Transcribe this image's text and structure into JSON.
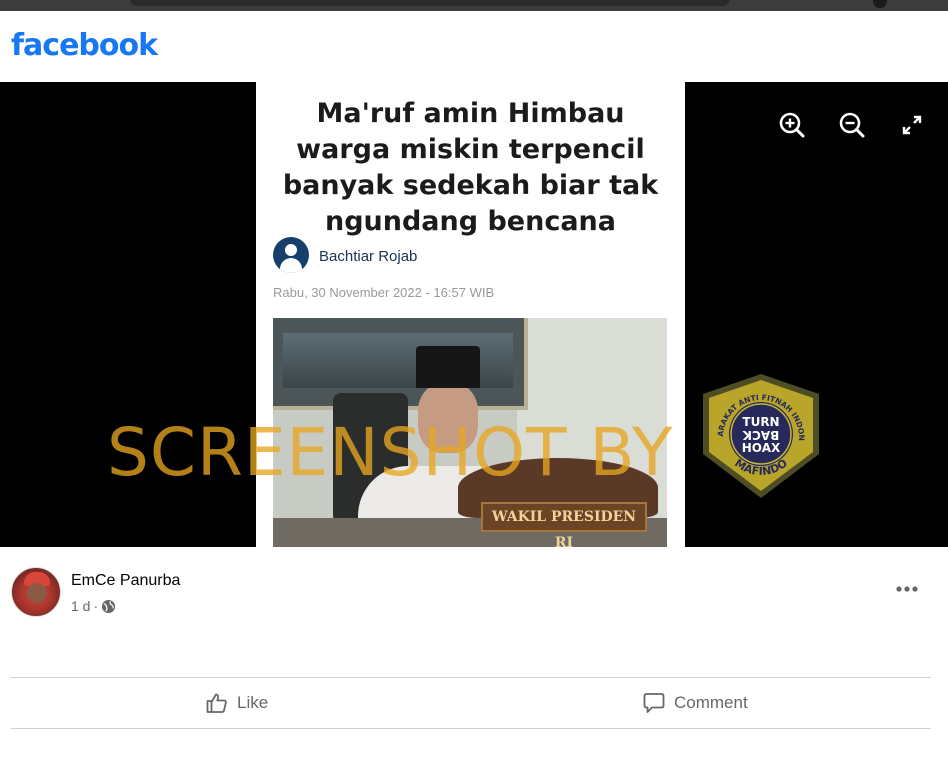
{
  "brand": {
    "logo_text": "facebook",
    "color": "#1877f2"
  },
  "viewer": {
    "headline": "Ma'ruf amin Himbau\nwarga miskin terpencil\nbanyak sedekah biar tak\nngundang bencana",
    "article_author": "Bachtiar Rojab",
    "article_date": "Rabu, 30 November 2022 - 16:57 WIB",
    "photo_plaque_text": "WAKIL PRESIDEN RI",
    "watermark_text": "SCREENSHOT BY",
    "badge": {
      "ring_text": "MASYARAKAT ANTI FITNAH INDONESIA",
      "bottom_text": "MAFINDO",
      "center_lines": [
        "TURN",
        "BACK",
        "HOAX"
      ]
    },
    "controls": [
      "zoom-in-icon",
      "zoom-out-icon",
      "fullscreen-icon"
    ]
  },
  "post": {
    "poster_name": "EmCe Panurba",
    "time": "1 d",
    "separator": "·",
    "audience_icon": "globe-icon",
    "actions": {
      "like": "Like",
      "comment": "Comment"
    }
  }
}
